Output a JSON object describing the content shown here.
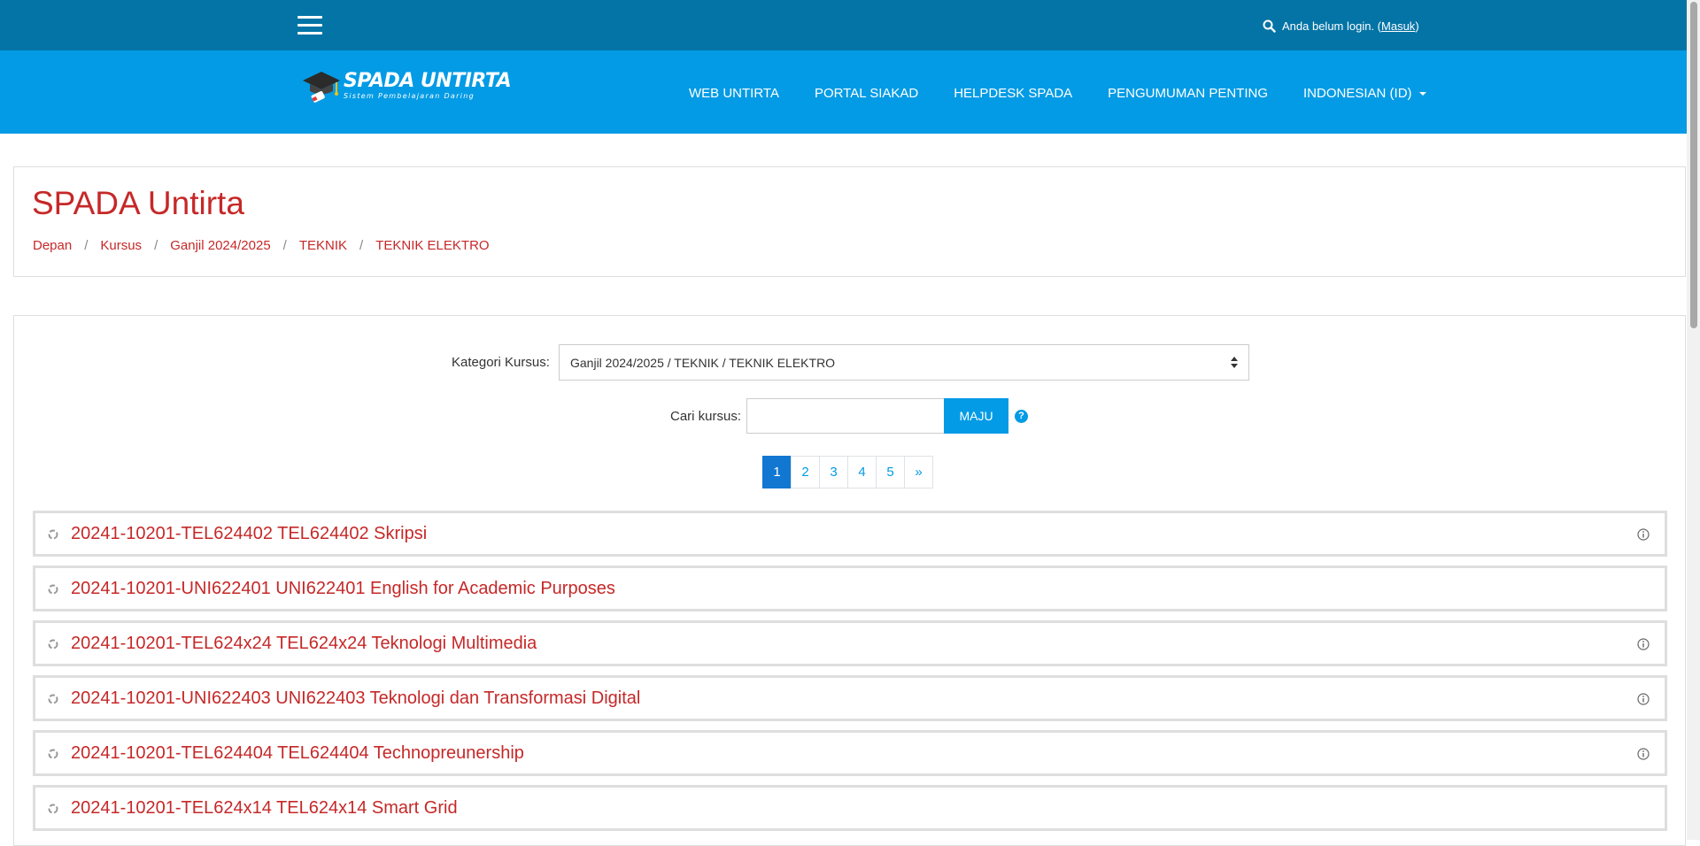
{
  "topbar": {
    "login_prefix": "Anda belum login. (",
    "login_link": "Masuk",
    "login_suffix": ")"
  },
  "brand": {
    "title": "SPADA UNTIRTA",
    "subtitle": "Sistem Pembelajaran Daring"
  },
  "nav": {
    "items": [
      {
        "label": "WEB UNTIRTA"
      },
      {
        "label": "PORTAL SIAKAD"
      },
      {
        "label": "HELPDESK SPADA"
      },
      {
        "label": "PENGUMUMAN PENTING"
      },
      {
        "label": "INDONESIAN (ID)"
      }
    ]
  },
  "header": {
    "title": "SPADA Untirta",
    "breadcrumb": [
      "Depan",
      "Kursus",
      "Ganjil 2024/2025",
      "TEKNIK",
      "TEKNIK ELEKTRO"
    ]
  },
  "filter": {
    "category_label": "Kategori Kursus:",
    "category_value": "Ganjil 2024/2025 / TEKNIK / TEKNIK ELEKTRO",
    "search_label": "Cari kursus:",
    "search_value": "",
    "search_button": "MAJU"
  },
  "pagination": {
    "pages": [
      "1",
      "2",
      "3",
      "4",
      "5",
      "»"
    ],
    "active": "1"
  },
  "courses": [
    {
      "name": "20241-10201-TEL624402 TEL624402 Skripsi",
      "has_info": true
    },
    {
      "name": "20241-10201-UNI622401 UNI622401 English for Academic Purposes",
      "has_info": false
    },
    {
      "name": "20241-10201-TEL624x24 TEL624x24 Teknologi Multimedia",
      "has_info": true
    },
    {
      "name": "20241-10201-UNI622403 UNI622403 Teknologi dan Transformasi Digital",
      "has_info": true
    },
    {
      "name": "20241-10201-TEL624404 TEL624404 Technopreunership",
      "has_info": true
    },
    {
      "name": "20241-10201-TEL624x14 TEL624x14 Smart Grid",
      "has_info": false
    }
  ],
  "colors": {
    "topbar": "#0474a6",
    "navband": "#039be5",
    "accent_red": "#c62828",
    "active_page": "#1177d1"
  },
  "icons": {
    "menu": "hamburger-icon",
    "search": "search-icon",
    "help": "question-circle-icon",
    "course": "course-category-icon",
    "info": "info-circle-icon"
  }
}
